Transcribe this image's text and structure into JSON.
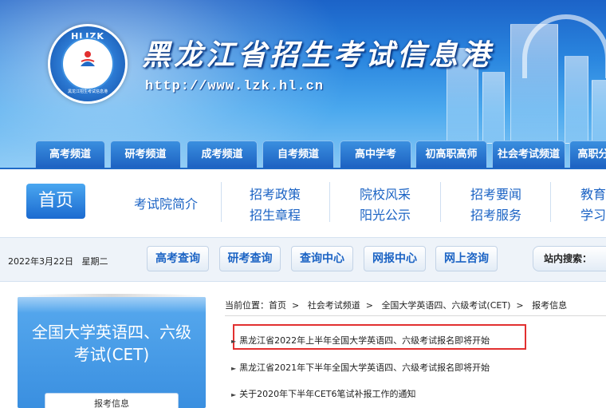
{
  "header": {
    "logo_abbr": "HLJZK",
    "logo_ring_text": "黑龙江招生考试信息港",
    "site_title": "黑龙江省招生考试信息港",
    "site_url": "http://www.lzk.hl.cn"
  },
  "channel_tabs": [
    "高考频道",
    "研考频道",
    "成考频道",
    "自考频道",
    "高中学考",
    "初高职高师",
    "社会考试频道",
    "高职分"
  ],
  "main_nav": {
    "home": "首页",
    "links": [
      [
        "考试院简介"
      ],
      [
        "招考政策",
        "招生章程"
      ],
      [
        "院校风采",
        "阳光公示"
      ],
      [
        "招考要闻",
        "招考服务"
      ],
      [
        "教育",
        "学习"
      ]
    ]
  },
  "toolbar": {
    "date": "2022年3月22日",
    "weekday": "星期二",
    "buttons": [
      "高考查询",
      "研考查询",
      "查询中心",
      "网报中心",
      "网上咨询"
    ],
    "search_label": "站内搜索："
  },
  "sidebar": {
    "title_line1": "全国大学英语四、六级",
    "title_line2": "考试(CET)",
    "sub_item": "报考信息"
  },
  "content": {
    "breadcrumb": [
      "当前位置：首页",
      "社会考试频道",
      "全国大学英语四、六级考试(CET)",
      "报考信息"
    ],
    "articles": [
      "黑龙江省2022年上半年全国大学英语四、六级考试报名即将开始",
      "黑龙江省2021年下半年全国大学英语四、六级考试报名即将开始",
      "关于2020年下半年CET6笔试补报工作的通知"
    ]
  },
  "colors": {
    "brand_blue": "#1f6ac6",
    "highlight_red": "#e23030"
  }
}
